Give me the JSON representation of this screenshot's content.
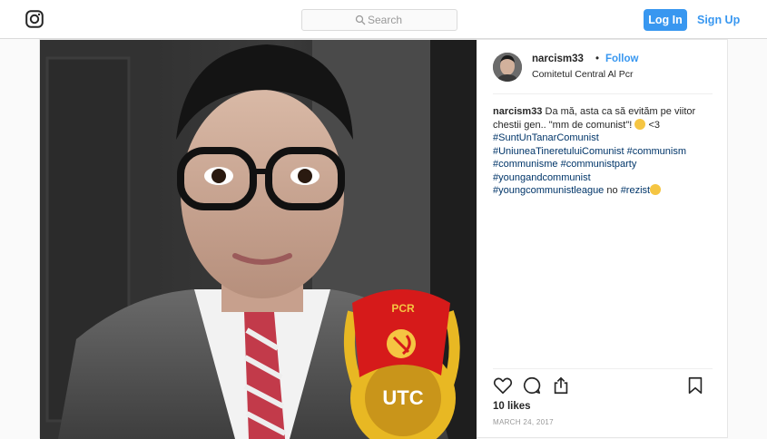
{
  "topbar": {
    "logo_icon": "instagram-icon",
    "search": {
      "placeholder": "Search",
      "icon": "search-icon"
    },
    "login_label": "Log In",
    "signup_label": "Sign Up",
    "accent_color": "#3897f0"
  },
  "post": {
    "username": "narcism33",
    "separator": "•",
    "follow_label": "Follow",
    "location": "Comitetul Central Al Pcr",
    "caption": {
      "username": "narcism33",
      "text1": "Da mă, asta ca să evităm pe viitor chestii gen.. \"mm de comunist\"!",
      "text2": "<3",
      "tags": [
        "#SuntUnTanarComunist",
        "#UniuneaTineretuluiComunist",
        "#communism",
        "#communisme",
        "#communistparty",
        "#youngandcommunist",
        "#youngcommunistleague"
      ],
      "text3": "no",
      "tag_last": "#rezist"
    },
    "photo": {
      "emblem_text": "UTC",
      "flag_text": "PCR"
    },
    "actions": [
      "heart-icon",
      "comment-icon",
      "share-icon",
      "bookmark-icon"
    ],
    "likes": "10 likes",
    "date": "MARCH 24, 2017"
  }
}
